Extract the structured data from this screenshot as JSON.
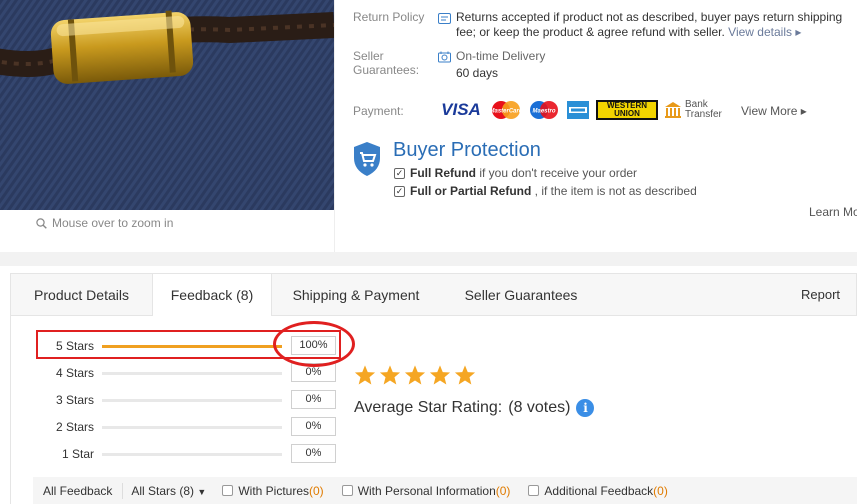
{
  "zoom_hint": "Mouse over to zoom in",
  "return_policy": {
    "label": "Return Policy",
    "text": "Returns accepted if product not as described, buyer pays return shipping fee; or keep the product & agree refund with seller.",
    "link": "View details"
  },
  "seller_guarantees": {
    "label": "Seller Guarantees:",
    "delivery_label": "On-time Delivery",
    "delivery_days": "60 days"
  },
  "payment": {
    "label": "Payment:",
    "methods": [
      "VISA",
      "MasterCard",
      "Maestro",
      "American Express",
      "WESTERN UNION",
      "Bank Transfer"
    ],
    "view_more": "View More"
  },
  "buyer_protection": {
    "title": "Buyer Protection",
    "items": [
      {
        "bold": "Full Refund",
        "rest": " if you don't receive your order"
      },
      {
        "bold": "Full or Partial Refund",
        "rest": " , if the item is not as described"
      }
    ],
    "learn_more": "Learn More"
  },
  "tabs": [
    {
      "label": "Product Details",
      "active": false
    },
    {
      "label": "Feedback (8)",
      "active": true
    },
    {
      "label": "Shipping & Payment",
      "active": false
    },
    {
      "label": "Seller Guarantees",
      "active": false
    }
  ],
  "report": "Report",
  "rating_rows": [
    {
      "label": "5 Stars",
      "percent": "100%",
      "fill_fraction": 1.0
    },
    {
      "label": "4 Stars",
      "percent": "0%",
      "fill_fraction": 0
    },
    {
      "label": "3 Stars",
      "percent": "0%",
      "fill_fraction": 0
    },
    {
      "label": "2 Stars",
      "percent": "0%",
      "fill_fraction": 0
    },
    {
      "label": "1 Star",
      "percent": "0%",
      "fill_fraction": 0
    }
  ],
  "average": {
    "stars": 5,
    "label": "Average Star Rating:",
    "votes": "(8 votes)"
  },
  "filters": {
    "all_feedback": "All Feedback",
    "all_stars": "All Stars (8)",
    "with_pictures": "With Pictures",
    "with_pictures_count": "(0)",
    "with_personal": "With Personal Information",
    "with_personal_count": "(0)",
    "additional": "Additional Feedback",
    "additional_count": "(0)"
  },
  "colors": {
    "accent_blue": "#2a6db5",
    "bar_orange": "#f0a020",
    "star_orange": "#f5a623",
    "highlight_red": "#e02020"
  }
}
